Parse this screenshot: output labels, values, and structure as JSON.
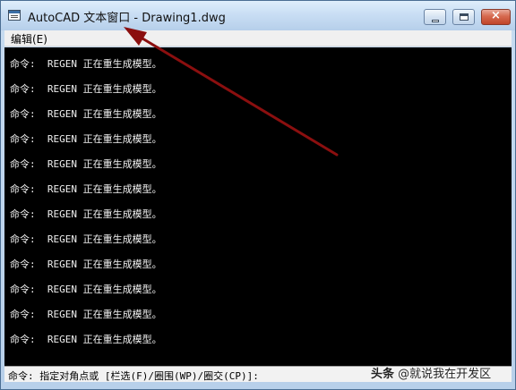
{
  "window": {
    "title": "AutoCAD 文本窗口 - Drawing1.dwg",
    "icon": "autocad-text-window-icon",
    "controls": {
      "minimize": "minimize-icon",
      "maximize": "maximize-icon",
      "close": "×"
    }
  },
  "menubar": {
    "items": [
      {
        "label": "编辑(E)"
      }
    ]
  },
  "console": {
    "lines": [
      "命令:  REGEN 正在重生成模型。",
      "命令:  REGEN 正在重生成模型。",
      "命令:  REGEN 正在重生成模型。",
      "命令:  REGEN 正在重生成模型。",
      "命令:  REGEN 正在重生成模型。",
      "命令:  REGEN 正在重生成模型。",
      "命令:  REGEN 正在重生成模型。",
      "命令:  REGEN 正在重生成模型。",
      "命令:  REGEN 正在重生成模型。",
      "命令:  REGEN 正在重生成模型。",
      "命令:  REGEN 正在重生成模型。",
      "命令:  REGEN 正在重生成模型。"
    ],
    "background": "#000000",
    "text_color": "#f0f0f0"
  },
  "prompt": {
    "text": "命令: 指定对角点或 [栏选(F)/圈围(WP)/圈交(CP)]:"
  },
  "watermark": {
    "brand": "头条",
    "handle": "@就说我在开发区"
  },
  "annotation": {
    "arrow_color": "#8b0f0f"
  }
}
